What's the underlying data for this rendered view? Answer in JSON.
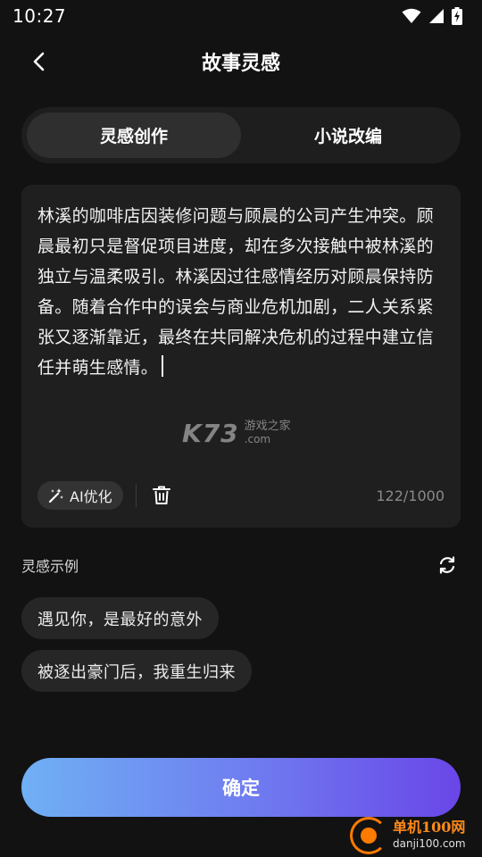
{
  "status": {
    "time": "10:27"
  },
  "header": {
    "title": "故事灵感"
  },
  "tabs": [
    {
      "label": "灵感创作",
      "active": true
    },
    {
      "label": "小说改编",
      "active": false
    }
  ],
  "editor": {
    "text": "林溪的咖啡店因装修问题与顾晨的公司产生冲突。顾晨最初只是督促项目进度，却在多次接触中被林溪的独立与温柔吸引。林溪因过往感情经历对顾晨保持防备。随着合作中的误会与商业危机加剧，二人关系紧张又逐渐靠近，最终在共同解决危机的过程中建立信任并萌生感情。",
    "ai_label": "AI优化",
    "counter": "122/1000"
  },
  "watermark": {
    "logo": "K73",
    "line1": "游戏之家",
    "line2": ".com"
  },
  "examples": {
    "title": "灵感示例",
    "items": [
      "遇见你，是最好的意外",
      "被逐出豪门后，我重生归来"
    ]
  },
  "confirm_label": "确定",
  "corner_logo": {
    "name": "单机100网",
    "url": "danji100.com"
  },
  "colors": {
    "background": "#121212",
    "accent_start": "#6fb0f4",
    "accent_end": "#6a46e8"
  }
}
